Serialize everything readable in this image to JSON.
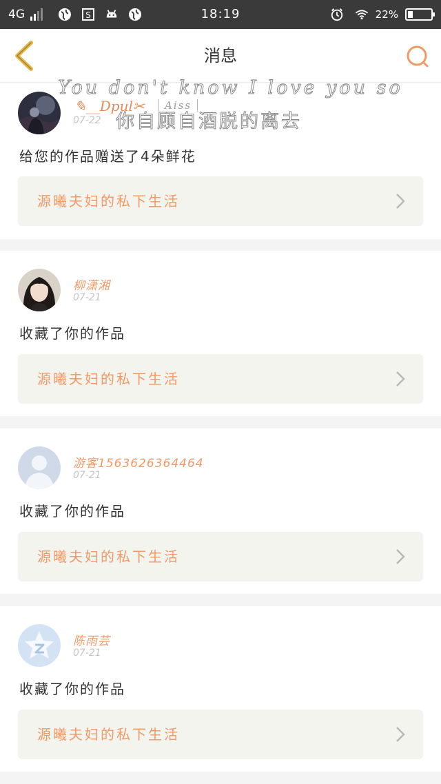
{
  "status_bar": {
    "network": "4G",
    "time": "18:19",
    "battery": "22%",
    "battery_level": 0.22
  },
  "header": {
    "title": "消息"
  },
  "watermark": {
    "line1": "You don't know I love you so",
    "signature": "✎__Dpul✂",
    "tag": "Aiss",
    "line2": "你自顾自酒脱的离去"
  },
  "colors": {
    "accent": "#f09a67",
    "back_arrow": "#e5b64a"
  },
  "messages": [
    {
      "username": "",
      "date": "07-22",
      "action": "给您的作品赠送了4朵鲜花",
      "work_title": "源曦夫妇的私下生活",
      "avatar": "photo-avatar-dark"
    },
    {
      "username": "柳潇湘",
      "date": "07-21",
      "action": "收藏了你的作品",
      "work_title": "源曦夫妇的私下生活",
      "avatar": "photo-avatar-girl"
    },
    {
      "username": "游客1563626364464",
      "date": "07-21",
      "action": "收藏了你的作品",
      "work_title": "源曦夫妇的私下生活",
      "avatar": "default-user-icon"
    },
    {
      "username": "陈雨芸",
      "date": "07-21",
      "action": "收藏了你的作品",
      "work_title": "源曦夫妇的私下生活",
      "avatar": "qzone-star-icon"
    }
  ]
}
